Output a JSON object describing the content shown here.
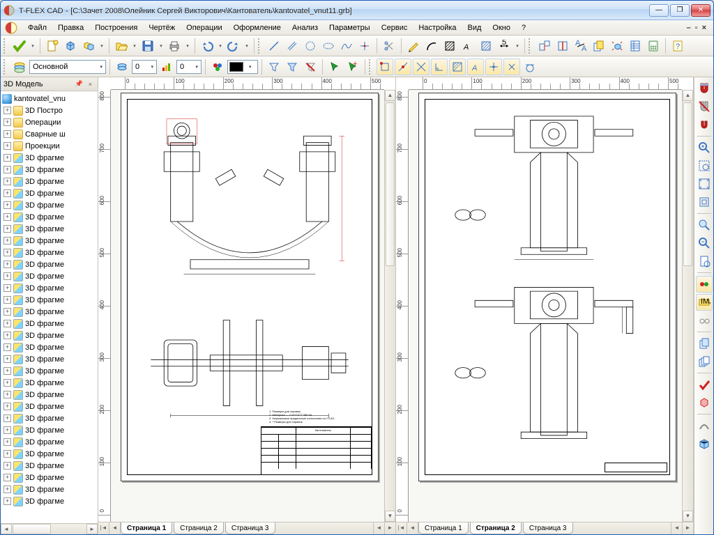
{
  "window": {
    "app": "T-FLEX CAD",
    "doc_path": "[C:\\Зачет 2008\\Олейник Сергей Викторович\\Кантователь\\kantovatel_vnut11.grb]"
  },
  "menus": [
    "Файл",
    "Правка",
    "Построения",
    "Чертёж",
    "Операции",
    "Оформление",
    "Анализ",
    "Параметры",
    "Сервис",
    "Настройка",
    "Вид",
    "Окно",
    "?"
  ],
  "toolbar2": {
    "layer_combo": "Основной",
    "num1": "0",
    "num2": "0"
  },
  "sidebar": {
    "title": "3D Модель",
    "root": "kantovatel_vnu",
    "folders": [
      "3D Постро",
      "Операции",
      "Сварные ш",
      "Проекции"
    ],
    "frag_label": "3D фрагме",
    "frag_count": 30
  },
  "rulers": {
    "h": [
      "0",
      "100",
      "200",
      "300",
      "400",
      "500"
    ],
    "h2": [
      "0",
      "100",
      "200",
      "300",
      "400",
      "500"
    ],
    "v": [
      "800",
      "700",
      "600",
      "500",
      "400",
      "300",
      "200",
      "100",
      "0"
    ]
  },
  "pages_left": {
    "tabs": [
      "Страница 1",
      "Страница 2",
      "Страница 3"
    ],
    "active": 0
  },
  "pages_right": {
    "tabs": [
      "Страница 1",
      "Страница 2",
      "Страница 3"
    ],
    "active": 1
  },
  "titleblock": {
    "name": "Кантователь"
  },
  "colors": {
    "accent": "#3b76c4",
    "red": "#d02020"
  }
}
